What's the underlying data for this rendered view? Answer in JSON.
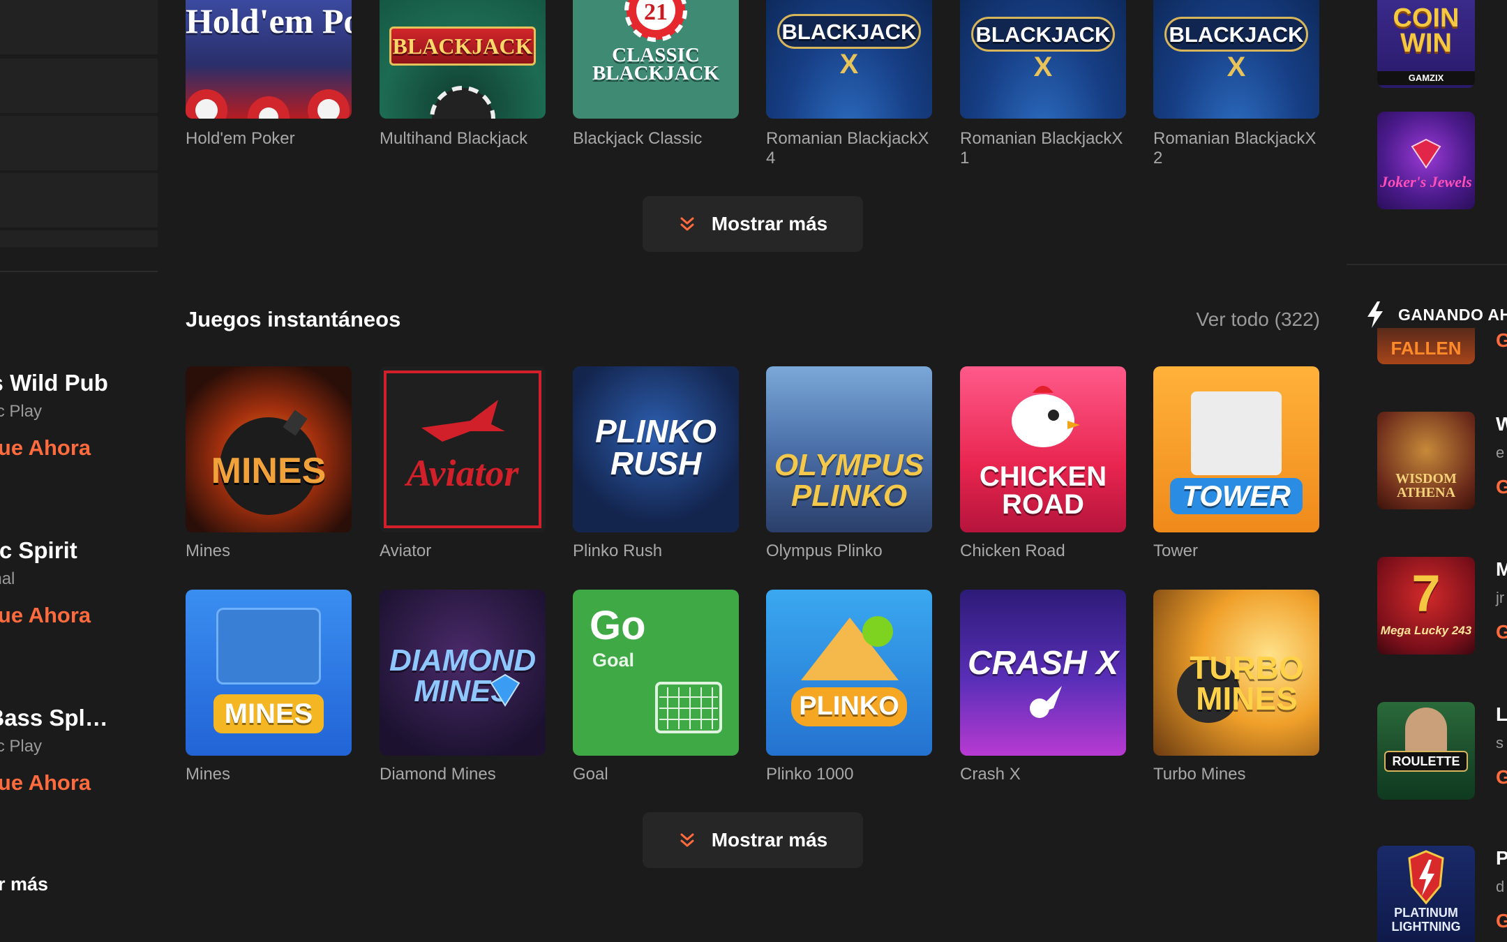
{
  "left_sidebar": {
    "promos": [
      {
        "title": "ky's Wild Pub",
        "subtitle": "natic Play",
        "cta": "gue Ahora"
      },
      {
        "title": "estic Spirit",
        "subtitle": "menal",
        "cta": "gue Ahora"
      },
      {
        "title": "er Bass Spl…",
        "subtitle": "natic Play",
        "cta": "gue Ahora"
      }
    ],
    "more_label": "ar más"
  },
  "top_row": {
    "games": [
      {
        "name": "Hold'em Poker",
        "art": "Hold'em Poker"
      },
      {
        "name": "Multihand Blackjack",
        "art": "BLACKJACK"
      },
      {
        "name": "Blackjack Classic",
        "art": "CLASSIC BLACKJACK"
      },
      {
        "name": "Romanian BlackjackX",
        "name2": "4",
        "art": "BLACKJACK"
      },
      {
        "name": "Romanian BlackjackX",
        "name2": "1",
        "art": "BLACKJACK"
      },
      {
        "name": "Romanian BlackjackX",
        "name2": "2",
        "art": "BLACKJACK"
      }
    ],
    "show_more": "Mostrar más"
  },
  "instant_games": {
    "title": "Juegos instantáneos",
    "see_all": "Ver todo (322)",
    "row1": [
      {
        "name": "Mines",
        "art": "MINES"
      },
      {
        "name": "Aviator",
        "art": "Aviator"
      },
      {
        "name": "Plinko Rush",
        "art": "PLINKO RUSH"
      },
      {
        "name": "Olympus Plinko",
        "art": "OLYMPUS PLINKO"
      },
      {
        "name": "Chicken Road",
        "art": "CHICKEN ROAD"
      },
      {
        "name": "Tower",
        "art": "TOWER"
      }
    ],
    "row2": [
      {
        "name": "Mines",
        "art": "MINES"
      },
      {
        "name": "Diamond Mines",
        "art": "DIAMOND MINES"
      },
      {
        "name": "Goal",
        "art": "Go",
        "art2": "Goal"
      },
      {
        "name": "Plinko 1000",
        "art": "PLINKO"
      },
      {
        "name": "Crash X",
        "art": "CRASH X"
      },
      {
        "name": "Turbo Mines",
        "art": "TURBO MINES"
      }
    ],
    "show_more": "Mostrar más"
  },
  "right_panel": {
    "top_tiles": [
      {
        "art": "COIN WIN",
        "sub": "GAMZIX"
      },
      {
        "art": "Joker's Jewels"
      }
    ],
    "winning_now": "GANANDO AH",
    "winning_items": [
      {
        "art": "FALLEN",
        "letter": "",
        "sub": "",
        "cta": "G"
      },
      {
        "art": "WISDOM ATHENA",
        "letter": "W",
        "sub": "e",
        "cta": "G"
      },
      {
        "art": "Mega Lucky 243",
        "letter": "M",
        "sub": "jr",
        "cta": "G"
      },
      {
        "art": "ROULETTE",
        "letter": "L",
        "sub": "s",
        "cta": "G"
      },
      {
        "art": "PLATINUM LIGHTNING",
        "letter": "P",
        "sub": "d",
        "cta": "G"
      }
    ]
  },
  "colors": {
    "background": "#1b1b1b",
    "accent": "#ff6b3d",
    "muted_text": "#a8a8a8",
    "button_bg": "#262626"
  }
}
